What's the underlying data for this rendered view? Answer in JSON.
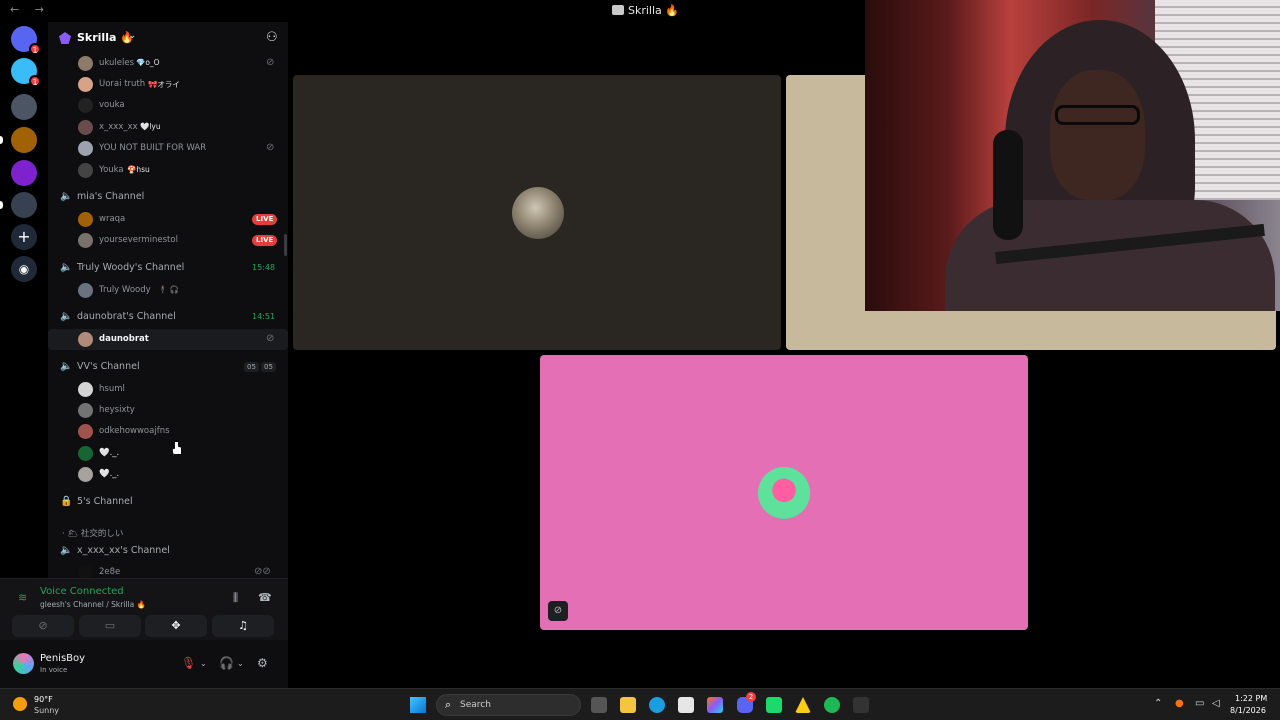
{
  "window": {
    "title": "Skrilla 🔥",
    "nav_back": "←",
    "nav_fwd": "→"
  },
  "guild": {
    "name": "Skrilla 🔥",
    "chevron": "⌄",
    "add_icon": "👤+"
  },
  "members_top": [
    {
      "name": "ukuleles",
      "tag": "💎o_O"
    },
    {
      "name": "Uorai truth",
      "tag": "🎀オライ"
    },
    {
      "name": "vouka",
      "tag": ""
    },
    {
      "name": "x_xxx_xx",
      "tag": "🤍lyu"
    },
    {
      "name": "YOU NOT BUILT FOR WAR",
      "tag": ""
    },
    {
      "name": "Youka",
      "tag": "🍄hsu"
    }
  ],
  "channels": {
    "mias": {
      "name": "mia's Channel",
      "members": [
        {
          "name": "wraqa",
          "live": "LIVE"
        },
        {
          "name": "yourseverminestol",
          "live": "LIVE"
        }
      ]
    },
    "woody": {
      "name": "Truly Woody's Channel",
      "time": "15:48",
      "member": "Truly Woody",
      "member_tag": "🕴 🎧"
    },
    "daunobrat": {
      "name": "daunobrat's Channel",
      "time": "14:51",
      "member": "daunobrat"
    },
    "vv": {
      "name": "VV's Channel",
      "count_a": "05",
      "count_b": "05",
      "members": [
        "hsuml",
        "heysixty",
        "odkehowwoajfns",
        "🤍._.",
        "🤍._."
      ]
    },
    "five": {
      "name": "5's Channel",
      "sub": "· 🌥 社交的しい"
    },
    "xxx": {
      "name": "x_xxx_xx's Channel",
      "member": "2e8e"
    }
  },
  "voice": {
    "status": "Voice Connected",
    "location": "gleesh's Channel / Skrilla 🔥"
  },
  "user": {
    "name": "PenisBoy",
    "status": "In voice"
  },
  "taskbar": {
    "temp": "90°F",
    "condition": "Sunny",
    "search": "Search",
    "time": "1:22 PM",
    "date": "8/1/2026",
    "discord_badge": "2"
  },
  "colors": {
    "tile_brown": "#2a2621",
    "tile_tan": "#c7b99b",
    "tile_pink": "#e46fb5",
    "connected_green": "#23a55a",
    "live_red": "#e33d3d"
  }
}
